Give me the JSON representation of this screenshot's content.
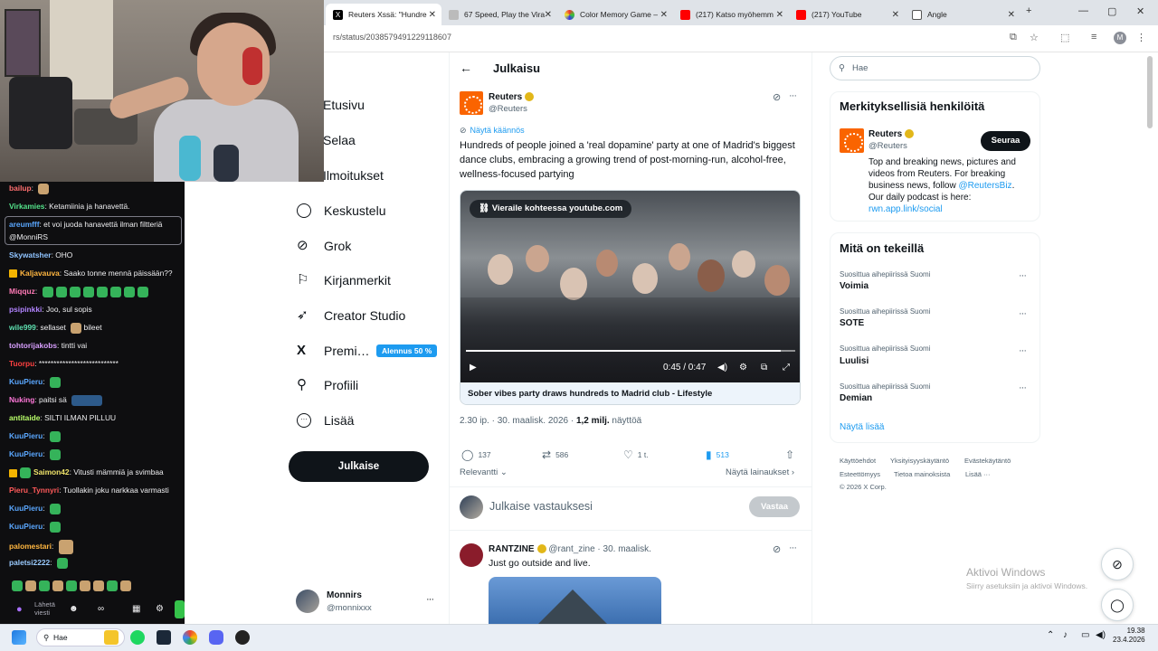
{
  "browser": {
    "tabs": [
      {
        "title": "Reuters Xssä: \"Hundre",
        "active": true
      },
      {
        "title": "67 Speed, Play the Vira"
      },
      {
        "title": "Color Memory Game –"
      },
      {
        "title": "(217) Katso myöhemm"
      },
      {
        "title": "(217) YouTube"
      },
      {
        "title": "Angle"
      }
    ],
    "new_tab": "+",
    "url": "rs/status/2038579491229118607",
    "profile_initial": "M"
  },
  "chat": {
    "messages": [
      {
        "user": "bailup",
        "text": "",
        "user_color": "#ff6f6f"
      },
      {
        "user": "Virkamies",
        "text": "Ketamiinia ja hanavettä.",
        "user_color": "#54e38a"
      },
      {
        "user": "areumfff",
        "text": "et voi juoda hanavettä ilman filtteriä",
        "user_color": "#5aa7ff"
      },
      {
        "user": "",
        "text": "@MonniRS",
        "user_color": "#efeff1"
      },
      {
        "user": "Skywatsher",
        "text": "OHO",
        "user_color": "#8fc3ff"
      },
      {
        "user": "Kaljavauva",
        "text": "Saako tonne mennä päissään??",
        "user_color": "#ffb640"
      },
      {
        "user": "Miqquz",
        "text": "",
        "user_color": "#ff7ab6"
      },
      {
        "user": "psipinkki",
        "text": "Joo, sul sopis",
        "user_color": "#b284ff"
      },
      {
        "user": "wile999",
        "text": "sellaset",
        "text2": "bileet",
        "user_color": "#5ee0b0"
      },
      {
        "user": "tohtorijakobs",
        "text": "tintti vai",
        "user_color": "#d9a0ff"
      },
      {
        "user": "Tuorpu",
        "text": "***************************",
        "user_color": "#ff4040"
      },
      {
        "user": "KuuPieru",
        "text": "",
        "user_color": "#5aa7ff"
      },
      {
        "user": "Nuking",
        "text": "paitsi sä",
        "user_color": "#ff77d9"
      },
      {
        "user": "antitaide",
        "text": "SILTI ILMAN PILLUU",
        "user_color": "#b9ff6a"
      },
      {
        "user": "KuuPieru",
        "text": "",
        "user_color": "#5aa7ff"
      },
      {
        "user": "KuuPieru",
        "text": "",
        "user_color": "#5aa7ff"
      },
      {
        "user": "Saimon42",
        "text": "Vitusti mämmiä ja svimbaa",
        "user_color": "#efe36a"
      },
      {
        "user": "Pieru_Tynnyri",
        "text": "Tuollakin joku narkkaa varmasti",
        "user_color": "#ff5a5a"
      },
      {
        "user": "KuuPieru",
        "text": "",
        "user_color": "#5aa7ff"
      },
      {
        "user": "KuuPieru",
        "text": "",
        "user_color": "#5aa7ff"
      },
      {
        "user": "palomestari",
        "text": "",
        "user_color": "#ffb640"
      },
      {
        "user": "paletsi2222",
        "text": "",
        "user_color": "#9acbff"
      }
    ],
    "send_label": "Lähetä viesti"
  },
  "nav": {
    "items": [
      "Etusivu",
      "Selaa",
      "Ilmoitukset",
      "Keskustelu",
      "Grok",
      "Kirjanmerkit",
      "Creator Studio",
      "Premi…",
      "Profiili",
      "Lisää"
    ],
    "premium_badge": "Alennus 50 %",
    "post_button": "Julkaise",
    "account_name": "Monnirs",
    "account_handle": "@monnixxx"
  },
  "main": {
    "header_title": "Julkaisu",
    "tweet": {
      "author": "Reuters",
      "handle": "@Reuters",
      "translate": "Näytä käännös",
      "text": "Hundreds of people joined a 'real dopamine' party at one of Madrid's biggest dance clubs, embracing a growing trend of post-morning-run, alcohol-free, wellness-focused partying",
      "video_link": "Vieraile kohteessa youtube.com",
      "video_time": "0:45 / 0:47",
      "video_progress": 0.957,
      "video_caption": "Sober vibes party draws hundreds to Madrid club - Lifestyle",
      "time": "2.30 ip. · 30. maalisk. 2026 · ",
      "views": "1,2 milj.",
      "views_label": " näyttöä",
      "replies": "137",
      "reposts": "586",
      "likes": "1 t.",
      "bookmarks": "513",
      "relevance": "Relevantti",
      "quotes": "Näytä lainaukset"
    },
    "reply_placeholder": "Julkaise vastauksesi",
    "reply_button": "Vastaa",
    "reply_tweet": {
      "author": "RANTZINE",
      "handle": "@rant_zine",
      "date": "· 30. maalisk.",
      "text": "Just go outside and live."
    }
  },
  "sidebar": {
    "search_placeholder": "Hae",
    "relevant_title": "Merkityksellisiä henkilöitä",
    "profile": {
      "name": "Reuters",
      "handle": "@Reuters",
      "follow": "Seuraa",
      "bio_1": "Top and breaking news, pictures and",
      "bio_2": "videos from Reuters. For breaking",
      "bio_3": "business news, follow ",
      "bio_link": "@ReutersBiz",
      "bio_4": "Our daily podcast is here:",
      "bio_url": "rwn.app.link/social"
    },
    "trends_title": "Mitä on tekeillä",
    "trends": [
      {
        "context": "Suosittua aihepiirissä Suomi",
        "name": "Voimia"
      },
      {
        "context": "Suosittua aihepiirissä Suomi",
        "name": "SOTE"
      },
      {
        "context": "Suosittua aihepiirissä Suomi",
        "name": "Luulisi"
      },
      {
        "context": "Suosittua aihepiirissä Suomi",
        "name": "Demian"
      }
    ],
    "show_more": "Näytä lisää",
    "footer": [
      "Käyttöehdot",
      "Yksityisyyskäytäntö",
      "Evästekäytäntö",
      "Esteettömyys",
      "Tietoa mainoksista",
      "Lisää ···",
      "© 2026 X Corp."
    ]
  },
  "windows": {
    "activate_title": "Aktivoi Windows",
    "activate_sub": "Siirry asetuksiin ja aktivoi Windows.",
    "search": "Hae",
    "time": "19.38",
    "date": "23.4.2026"
  }
}
